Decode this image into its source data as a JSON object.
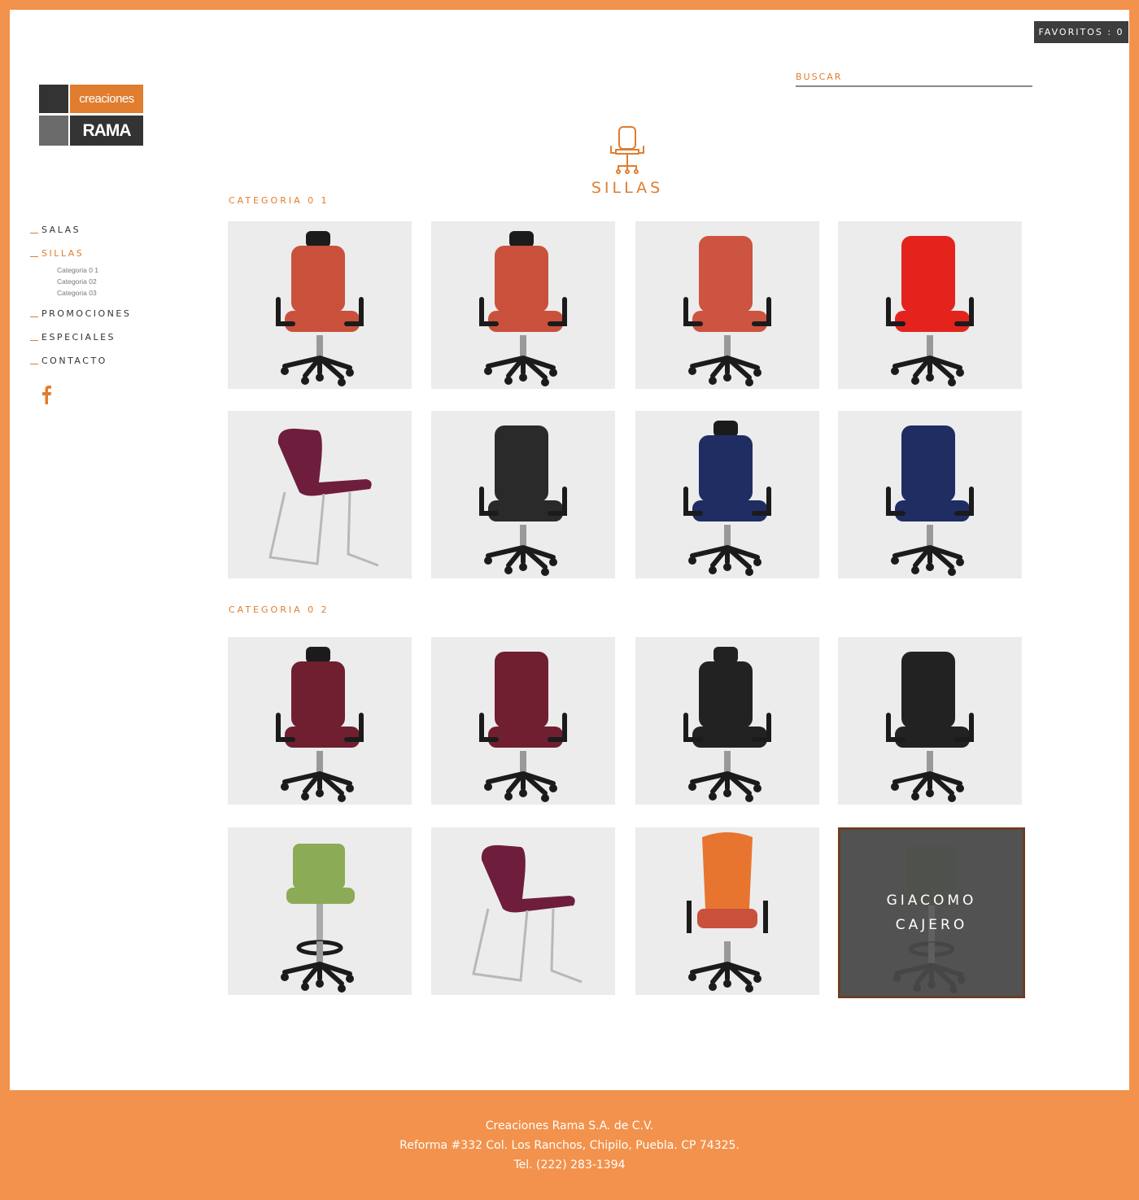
{
  "header": {
    "favorites_label": "FAVORITOS : 0",
    "search_placeholder": "BUSCAR"
  },
  "logo": {
    "top_text": "creaciones",
    "bottom_text": "RAMA"
  },
  "nav": {
    "items": [
      "SALAS",
      "SILLAS",
      "PROMOCIONES",
      "ESPECIALES",
      "CONTACTO"
    ],
    "active": "SILLAS",
    "subitems": [
      "Categoria 0 1",
      "Categoria 02",
      "Categoria 03"
    ]
  },
  "social": {
    "facebook_icon": "f"
  },
  "hero": {
    "icon": "chair-icon",
    "title": "SILLAS"
  },
  "categories": [
    "CATEGORIA 0 1",
    "CATEGORIA 0 2"
  ],
  "products": [
    {
      "color": "#c9513c",
      "style": "task-headrest"
    },
    {
      "color": "#c9513c",
      "style": "task-headrest-side"
    },
    {
      "color": "#cc5440",
      "style": "task"
    },
    {
      "color": "#e4231d",
      "style": "task-side"
    },
    {
      "color": "#6e1e3c",
      "style": "sled"
    },
    {
      "color": "#2a2a2a",
      "style": "exec-arm"
    },
    {
      "color": "#1f2d63",
      "style": "task-headrest"
    },
    {
      "color": "#1f2d63",
      "style": "task"
    },
    {
      "color": "#701f30",
      "style": "task-headrest"
    },
    {
      "color": "#701f30",
      "style": "task"
    },
    {
      "color": "#222222",
      "style": "exec-headrest"
    },
    {
      "color": "#222222",
      "style": "exec-arm"
    },
    {
      "color": "#8cab56",
      "style": "stool"
    },
    {
      "color": "#6e1e3c",
      "style": "sled-side"
    },
    {
      "color": "#e8752f",
      "style": "mesh"
    },
    {
      "color": "#4a5a34",
      "style": "stool",
      "hover": true,
      "overlay_lines": [
        "GIACOMO",
        "CAJERO"
      ]
    }
  ],
  "footer": {
    "line1": "Creaciones Rama S.A. de C.V.",
    "line2": "Reforma #332 Col. Los Ranchos, Chipilo, Puebla. CP 74325.",
    "line3": "Tel. (222) 283-1394"
  },
  "colors": {
    "accent": "#e07d2f",
    "frame": "#f2924c",
    "dark": "#3d3d3d"
  }
}
